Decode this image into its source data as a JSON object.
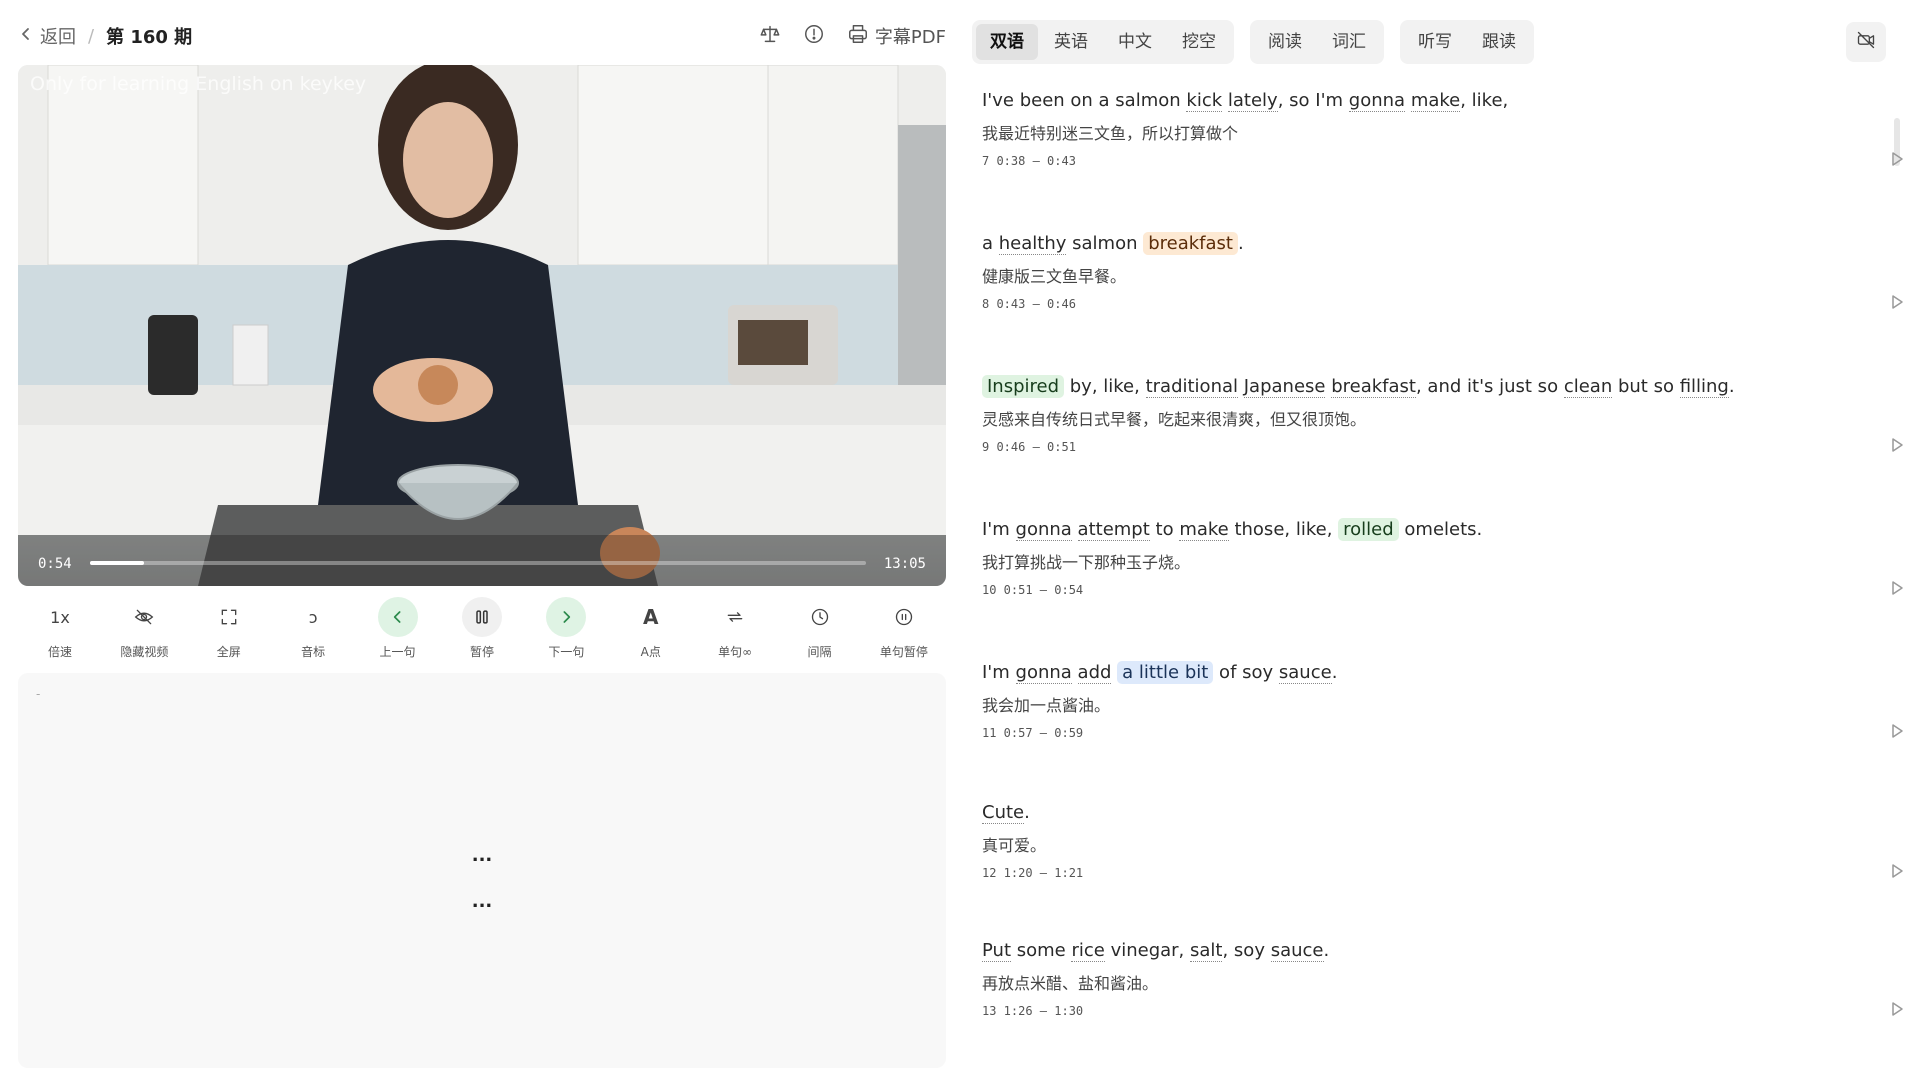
{
  "header": {
    "back_label": "返回",
    "separator": "/",
    "episode_title": "第 160 期",
    "pdf_label": "字幕PDF"
  },
  "video": {
    "watermark": "Only for learning English on keykey",
    "corner_mark": "keykey",
    "current_time": "0:54",
    "total_time": "13:05",
    "progress_fraction": 0.069
  },
  "controls": [
    {
      "label": "倍速",
      "icon": "1x",
      "icon_name": "speed-icon"
    },
    {
      "label": "隐藏视频",
      "icon": "",
      "icon_name": "eye-off-icon"
    },
    {
      "label": "全屏",
      "icon": "",
      "icon_name": "fullscreen-icon"
    },
    {
      "label": "音标",
      "icon": "ɔ",
      "icon_name": "phonetic-icon"
    },
    {
      "label": "上一句",
      "icon": "",
      "icon_name": "chevron-left-icon"
    },
    {
      "label": "暂停",
      "icon": "",
      "icon_name": "pause-icon"
    },
    {
      "label": "下一句",
      "icon": "",
      "icon_name": "chevron-right-icon"
    },
    {
      "label": "A点",
      "icon": "A",
      "icon_name": "a-point-icon"
    },
    {
      "label": "单句∞",
      "icon": "",
      "icon_name": "repeat-icon"
    },
    {
      "label": "间隔",
      "icon": "",
      "icon_name": "clock-icon"
    },
    {
      "label": "单句暂停",
      "icon": "",
      "icon_name": "pause-circle-icon"
    }
  ],
  "notes": {
    "dash": "-",
    "dots_1": "...",
    "dots_2": "..."
  },
  "tabs": {
    "group1": [
      "双语",
      "英语",
      "中文",
      "挖空"
    ],
    "group2": [
      "阅读",
      "词汇"
    ],
    "group3": [
      "听写",
      "跟读"
    ],
    "active": "双语"
  },
  "colors": {
    "highlight_orange": "#fde9d3",
    "highlight_green": "#dff3e1",
    "highlight_blue": "#dde9fb",
    "control_green": "#dff3e4"
  },
  "subtitles": [
    {
      "segments": [
        {
          "t": "I've been on a salmon "
        },
        {
          "t": "kick",
          "s": "w"
        },
        {
          "t": " "
        },
        {
          "t": "lately",
          "s": "w"
        },
        {
          "t": ", so I'm "
        },
        {
          "t": "gonna",
          "s": "w"
        },
        {
          "t": " "
        },
        {
          "t": "make",
          "s": "w"
        },
        {
          "t": ", like,"
        }
      ],
      "zh": "我最近特别迷三文鱼，所以打算做个",
      "meta": "7 0:38 – 0:43"
    },
    {
      "segments": [
        {
          "t": "a "
        },
        {
          "t": "healthy",
          "s": "w"
        },
        {
          "t": " salmon "
        },
        {
          "t": "breakfast",
          "s": "orange"
        },
        {
          "t": "."
        }
      ],
      "zh": "健康版三文鱼早餐。",
      "meta": "8 0:43 – 0:46"
    },
    {
      "segments": [
        {
          "t": "Inspired",
          "s": "green"
        },
        {
          "t": " by, like, "
        },
        {
          "t": "traditional",
          "s": "w"
        },
        {
          "t": " "
        },
        {
          "t": "Japanese",
          "s": "w"
        },
        {
          "t": " "
        },
        {
          "t": "breakfast",
          "s": "w"
        },
        {
          "t": ", and it's just so "
        },
        {
          "t": "clean",
          "s": "w"
        },
        {
          "t": " but so "
        },
        {
          "t": "filling",
          "s": "w"
        },
        {
          "t": "."
        }
      ],
      "zh": "灵感来自传统日式早餐，吃起来很清爽，但又很顶饱。",
      "meta": "9 0:46 – 0:51"
    },
    {
      "segments": [
        {
          "t": "I'm "
        },
        {
          "t": "gonna",
          "s": "w"
        },
        {
          "t": " "
        },
        {
          "t": "attempt",
          "s": "w"
        },
        {
          "t": " to "
        },
        {
          "t": "make",
          "s": "w"
        },
        {
          "t": " those, like, "
        },
        {
          "t": "rolled",
          "s": "green"
        },
        {
          "t": " omelets."
        }
      ],
      "zh": "我打算挑战一下那种玉子烧。",
      "meta": "10 0:51 – 0:54"
    },
    {
      "segments": [
        {
          "t": "I'm "
        },
        {
          "t": "gonna",
          "s": "w"
        },
        {
          "t": " "
        },
        {
          "t": "add",
          "s": "w"
        },
        {
          "t": " "
        },
        {
          "t": "a little bit",
          "s": "blue"
        },
        {
          "t": " of soy "
        },
        {
          "t": "sauce",
          "s": "w"
        },
        {
          "t": "."
        }
      ],
      "zh": "我会加一点酱油。",
      "meta": "11 0:57 – 0:59"
    },
    {
      "segments": [
        {
          "t": "Cute",
          "s": "w"
        },
        {
          "t": "."
        }
      ],
      "zh": "真可爱。",
      "meta": "12 1:20 – 1:21"
    },
    {
      "segments": [
        {
          "t": "Put",
          "s": "w"
        },
        {
          "t": " some "
        },
        {
          "t": "rice",
          "s": "w"
        },
        {
          "t": " vinegar, "
        },
        {
          "t": "salt",
          "s": "w"
        },
        {
          "t": ", soy "
        },
        {
          "t": "sauce",
          "s": "w"
        },
        {
          "t": "."
        }
      ],
      "zh": "再放点米醋、盐和酱油。",
      "meta": "13 1:26 – 1:30"
    }
  ]
}
